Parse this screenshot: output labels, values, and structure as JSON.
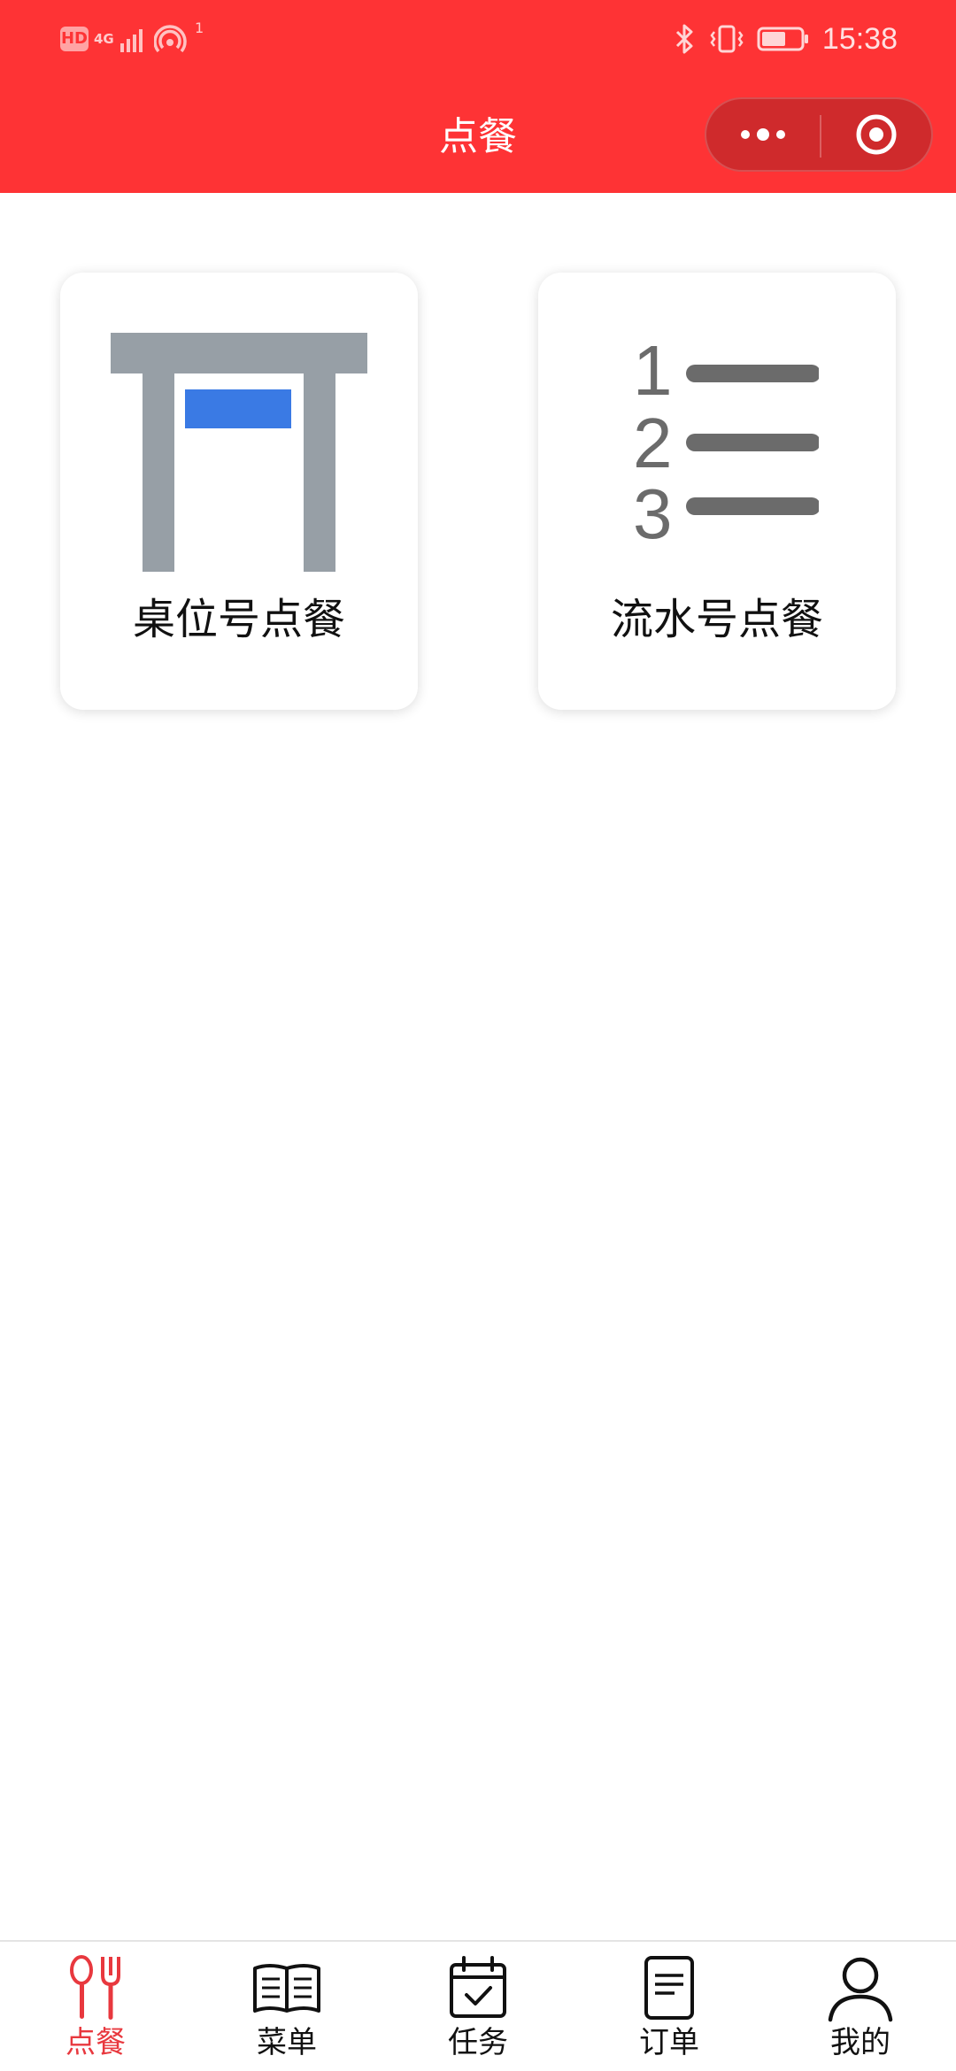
{
  "status_bar": {
    "hd": "HD",
    "network": "4G",
    "hotspot_count": "1",
    "time": "15:38"
  },
  "nav": {
    "title": "点餐"
  },
  "cards": [
    {
      "label": "桌位号点餐",
      "icon": "table-icon"
    },
    {
      "label": "流水号点餐",
      "icon": "numbered-list-icon"
    }
  ],
  "serial_icon_numbers": [
    "1",
    "2",
    "3"
  ],
  "tabs": [
    {
      "label": "点餐",
      "icon": "spoon-fork-icon",
      "active": true
    },
    {
      "label": "菜单",
      "icon": "open-book-icon",
      "active": false
    },
    {
      "label": "任务",
      "icon": "calendar-check-icon",
      "active": false
    },
    {
      "label": "订单",
      "icon": "document-icon",
      "active": false
    },
    {
      "label": "我的",
      "icon": "person-icon",
      "active": false
    }
  ],
  "colors": {
    "brand_red": "#fe3335",
    "active_tab": "#e8383e",
    "table_gray": "#979fa6",
    "table_blue": "#3a7ae4",
    "list_gray": "#6b6b6b"
  }
}
